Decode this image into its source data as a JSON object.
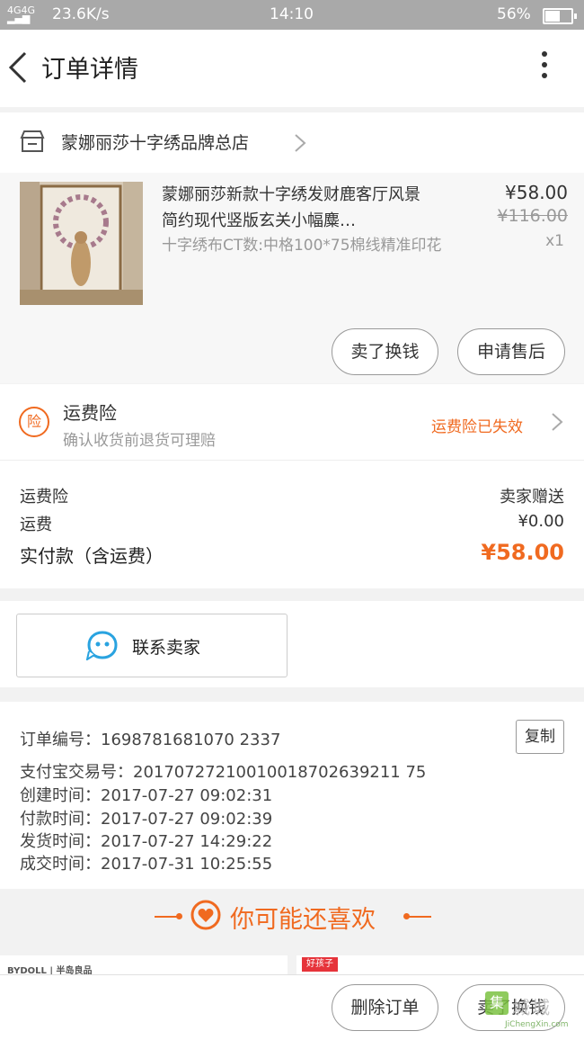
{
  "status_bar": {
    "network": "4G 4G",
    "speed": "23.6K/s",
    "time": "14:10",
    "battery": "56%",
    "battery_level": 0.56
  },
  "header": {
    "title": "订单详情"
  },
  "shop": {
    "name": "蒙娜丽莎十字绣品牌总店"
  },
  "item": {
    "name": "蒙娜丽莎新款十字绣发财鹿客厅风景简约现代竖版玄关小幅麋…",
    "sku": "十字绣布CT数:中格100*75棉线精准印花",
    "price": "¥58.00",
    "original_price": "¥116.00",
    "quantity": "x1",
    "buttons": [
      "卖了换钱",
      "申请售后"
    ]
  },
  "insurance": {
    "badge": "险",
    "title": "运费险",
    "desc": "确认收货前退货可理赔",
    "status": "运费险已失效"
  },
  "costs": {
    "rows": [
      {
        "label": "运费险",
        "value": "卖家赠送"
      },
      {
        "label": "运费",
        "value": "¥0.00"
      }
    ],
    "total_label": "实付款（含运费）",
    "total_value": "¥58.00"
  },
  "contact": {
    "label": "联系卖家"
  },
  "order_info": {
    "order_no": "订单编号：1698781681070 2337",
    "copy_label": "复制",
    "alipay_no": "支付宝交易号：20170727210010018702639211 75",
    "created": "创建时间：2017-07-27  09:02:31",
    "paid": "付款时间：2017-07-27  09:02:39",
    "shipped": "发货时间：2017-07-27  14:29:22",
    "completed": "成交时间：2017-07-31  10:25:55"
  },
  "recommend": {
    "title": "你可能还喜欢",
    "left_brand": "BYDOLL | 半岛良品",
    "right_tag": "好孩子"
  },
  "bottom_bar": {
    "delete_label": "删除订单",
    "sell_label": "卖了换钱"
  },
  "watermark": {
    "cn": "城城",
    "en": "JiChengXin.com",
    "mark": "集"
  },
  "colors": {
    "accent": "#f06a20",
    "status_bar": "#a9a9a9"
  }
}
